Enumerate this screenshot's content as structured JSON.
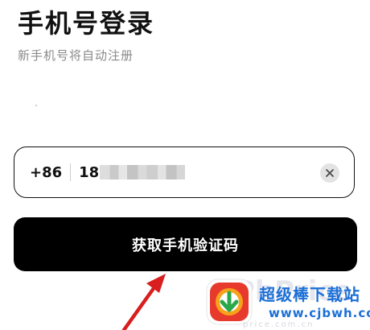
{
  "header": {
    "title": "手机号登录",
    "subtitle": "新手机号将自动注册"
  },
  "phone_input": {
    "country_code": "+86",
    "value_visible_prefix": "18",
    "value_masked": true,
    "clear_icon": "close-icon"
  },
  "actions": {
    "submit_label": "获取手机验证码"
  },
  "annotation": {
    "arrow_color": "#d81e1e"
  },
  "watermark": {
    "ghost_text": "PhPrice",
    "title": "超级棒下载站",
    "url": "www.cjbwh.com",
    "faint_url": "price.com.cn",
    "brand_color": "#1b6fd6"
  }
}
